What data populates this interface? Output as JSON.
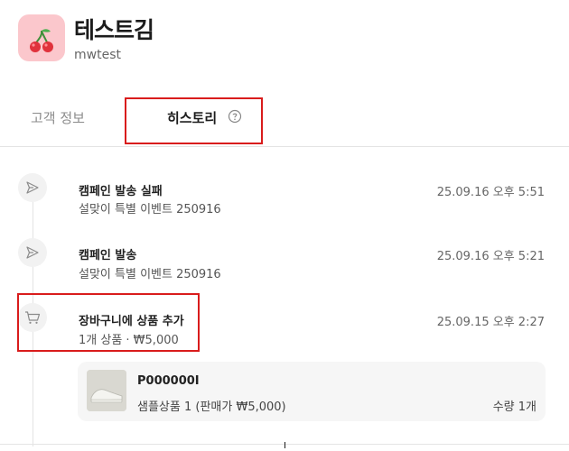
{
  "header": {
    "avatar_icon": "cherry-icon",
    "name": "테스트김",
    "user_id": "mwtest"
  },
  "tabs": [
    {
      "label": "고객 정보",
      "active": false
    },
    {
      "label": "히스토리",
      "active": true,
      "icon": "help-circle-icon"
    }
  ],
  "highlight_color": "#d91c1c",
  "history": [
    {
      "icon": "send-icon",
      "title": "캠페인 발송 실패",
      "subtitle": "설맞이 특별 이벤트 250916",
      "time": "25.09.16 오후 5:51"
    },
    {
      "icon": "send-icon",
      "title": "캠페인 발송",
      "subtitle": "설맞이 특별 이벤트 250916",
      "time": "25.09.16 오후 5:21"
    },
    {
      "icon": "cart-icon",
      "title": "장바구니에 상품 추가",
      "subtitle": "1개 상품 · ₩5,000",
      "time": "25.09.15 오후 2:27"
    }
  ],
  "product": {
    "code": "P000000I",
    "name_price": "샘플상품 1 (판매가 ₩5,000)",
    "quantity": "수량 1개"
  }
}
